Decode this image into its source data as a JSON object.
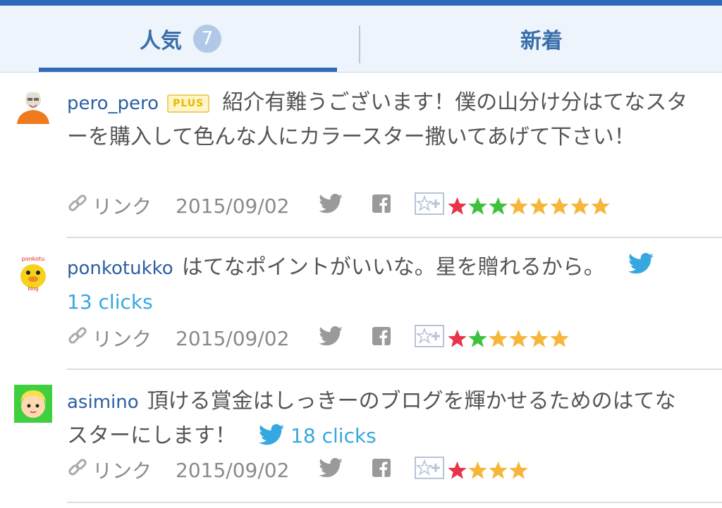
{
  "tabs": {
    "popular_label": "人気",
    "popular_count": "7",
    "new_label": "新着"
  },
  "entries": [
    {
      "user": "pero_pero",
      "plus_badge": "PLUS",
      "comment": "紹介有難うございます！僕の山分け分はてなスターを購入して色んな人にカラースター撒いてあげて下さい！",
      "link_label": "リンク",
      "date": "2015/09/02",
      "stars": [
        "red",
        "green",
        "green",
        "yellow",
        "yellow",
        "yellow",
        "yellow",
        "yellow"
      ]
    },
    {
      "user": "ponkotukko",
      "comment": "はてなポイントがいいな。星を贈れるから。",
      "clicks": "13 clicks",
      "link_label": "リンク",
      "date": "2015/09/02",
      "stars": [
        "red",
        "green",
        "yellow",
        "yellow",
        "yellow",
        "yellow"
      ]
    },
    {
      "user": "asimino",
      "comment": "頂ける賞金はしっきーのブログを輝かせるためのはてなスターにします！",
      "clicks": "18 clicks",
      "link_label": "リンク",
      "date": "2015/09/02",
      "stars": [
        "red",
        "yellow",
        "yellow",
        "yellow"
      ]
    }
  ],
  "colors": {
    "accent": "#2f6bb8",
    "username": "#2b5fa3",
    "twitter": "#35a8e0",
    "star_red": "#e8334a",
    "star_green": "#3cc23c",
    "star_yellow": "#f5b63a"
  }
}
